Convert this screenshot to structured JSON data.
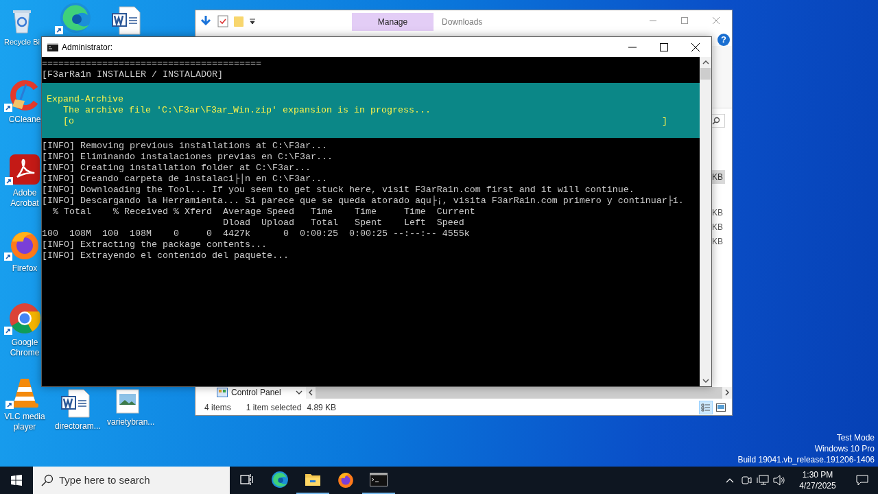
{
  "desktop_icons": [
    {
      "kind": "recycle",
      "label": "Recycle Bi"
    },
    {
      "kind": "edge"
    },
    {
      "kind": "word"
    },
    {
      "kind": "ccleaner",
      "label": "CCleane"
    },
    {
      "kind": "acrobat",
      "label": "Adobe Acrobat"
    },
    {
      "kind": "firefox",
      "label": "Firefox"
    },
    {
      "kind": "chrome",
      "label": "Google Chrome"
    },
    {
      "kind": "vlc",
      "label": "VLC media player"
    },
    {
      "kind": "word",
      "label": "directoram..."
    },
    {
      "kind": "image",
      "label": "varietybran..."
    }
  ],
  "explorer": {
    "title": "Downloads",
    "help": "?",
    "context_tab": "Manage",
    "size_rows": [
      {
        "size": "KB",
        "selected": true
      },
      {
        "size": "KB",
        "selected": false
      },
      {
        "size": "KB",
        "selected": false
      },
      {
        "size": "KB",
        "selected": false
      }
    ],
    "nav_item": "Control Panel",
    "status_bar": {
      "item_count": "4 items",
      "selection": "1 item selected",
      "size": "4.89 KB"
    }
  },
  "console": {
    "title": "Administrator:",
    "lines_before": [
      "========================================",
      "[F3arRa1n INSTALLER / INSTALADOR]"
    ],
    "progress": {
      "activity": "Expand-Archive",
      "status": "The archive file 'C:\\F3ar\\F3ar_Win.zip' expansion is in progress...",
      "bar_start": "[o",
      "bar_end": "]"
    },
    "lines_after": [
      "[INFO] Removing previous installations at C:\\F3ar...",
      "[INFO] Eliminando instalaciones previas en C:\\F3ar...",
      "[INFO] Creating installation folder at C:\\F3ar...",
      "[INFO] Creando carpeta de instalaci├│n en C:\\F3ar...",
      "[INFO] Downloading the Tool... If you seem to get stuck here, visit F3arRa1n.com first and it will continue.",
      "[INFO] Descargando la Herramienta... Si parece que se queda atorado aqu├¡, visita F3arRa1n.com primero y continuar├í.",
      "  % Total    % Received % Xferd  Average Speed   Time    Time     Time  Current",
      "                                 Dload  Upload   Total   Spent    Left  Speed",
      "100  108M  100  108M    0     0  4427k      0  0:00:25  0:00:25 --:--:-- 4555k",
      "[INFO] Extracting the package contents...",
      "[INFO] Extrayendo el contenido del paquete..."
    ]
  },
  "watermark": [
    "Test Mode",
    "Windows 10 Pro",
    "Build 19041.vb_release.191206-1406"
  ],
  "taskbar": {
    "search_placeholder": "Type here to search",
    "apps": [
      {
        "kind": "taskview",
        "running": false
      },
      {
        "kind": "edge",
        "running": false
      },
      {
        "kind": "explorer",
        "running": true
      },
      {
        "kind": "firefox",
        "running": false
      },
      {
        "kind": "console",
        "running": true
      }
    ],
    "time": "1:30 PM",
    "date": "4/27/2025"
  }
}
